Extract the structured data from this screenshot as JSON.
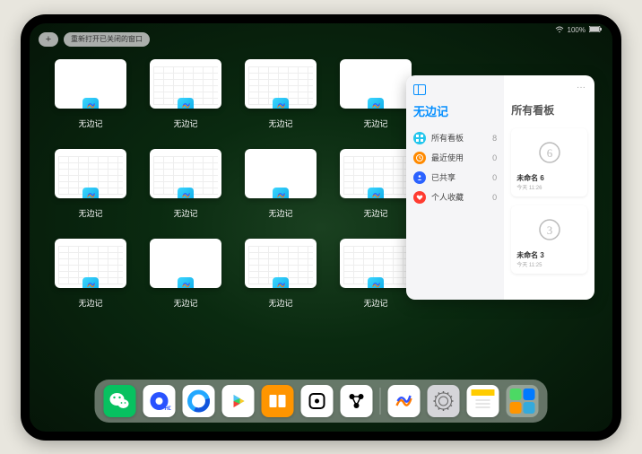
{
  "statusbar": {
    "battery": "100%"
  },
  "topbar": {
    "plus": "+",
    "reopen": "重新打开已关闭的窗口"
  },
  "appLabel": "无边记",
  "thumbs": [
    {
      "variant": "blank"
    },
    {
      "variant": "cal"
    },
    {
      "variant": "cal"
    },
    {
      "variant": "blank"
    },
    {
      "variant": "cal"
    },
    {
      "variant": "cal"
    },
    {
      "variant": "blank"
    },
    {
      "variant": "cal"
    },
    {
      "variant": "cal"
    },
    {
      "variant": "blank"
    },
    {
      "variant": "cal"
    },
    {
      "variant": "cal"
    }
  ],
  "card": {
    "leftTitle": "无边记",
    "rightTitle": "所有看板",
    "dots": "···",
    "nav": [
      {
        "icon": "grid",
        "color": "#23c6ed",
        "label": "所有看板",
        "count": "8"
      },
      {
        "icon": "clock",
        "color": "#ff8a00",
        "label": "最近使用",
        "count": "0"
      },
      {
        "icon": "share",
        "color": "#2b62ff",
        "label": "已共享",
        "count": "0"
      },
      {
        "icon": "heart",
        "color": "#ff3b30",
        "label": "个人收藏",
        "count": "0"
      }
    ],
    "boards": [
      {
        "digit": "6",
        "title": "未命名 6",
        "sub": "今天 11:26"
      },
      {
        "digit": "3",
        "title": "未命名 3",
        "sub": "今天 11:25"
      }
    ]
  },
  "dock": {
    "items": [
      {
        "name": "wechat",
        "bg": "#07c160"
      },
      {
        "name": "browser1",
        "bg": "#ffffff"
      },
      {
        "name": "browser2",
        "bg": "#ffffff"
      },
      {
        "name": "play",
        "bg": "#ffffff"
      },
      {
        "name": "books",
        "bg": "#ff9500"
      },
      {
        "name": "dice",
        "bg": "#ffffff"
      },
      {
        "name": "connect",
        "bg": "#ffffff"
      }
    ],
    "recents": [
      {
        "name": "freeform",
        "bg": "#ffffff"
      },
      {
        "name": "settings",
        "bg": "#d5d5d9"
      },
      {
        "name": "notes",
        "bg": "#ffffff"
      }
    ]
  }
}
